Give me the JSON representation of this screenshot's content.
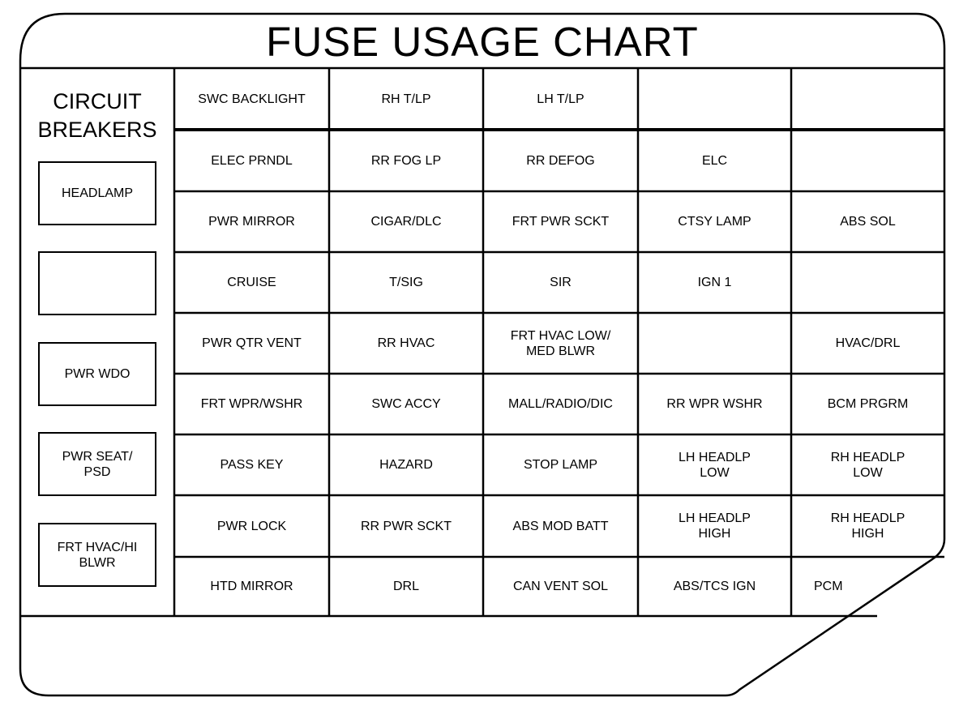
{
  "title": "FUSE USAGE CHART",
  "circuit_breakers": {
    "heading_line1": "CIRCUIT",
    "heading_line2": "BREAKERS",
    "items": [
      "HEADLAMP",
      "",
      "PWR WDO",
      "PWR SEAT/\nPSD",
      "FRT HVAC/HI\nBLWR"
    ]
  },
  "fuses": {
    "rows": [
      [
        "SWC BACKLIGHT",
        "RH T/LP",
        "LH T/LP",
        "",
        ""
      ],
      [
        "ELEC PRNDL",
        "RR FOG LP",
        "RR DEFOG",
        "ELC",
        ""
      ],
      [
        "PWR MIRROR",
        "CIGAR/DLC",
        "FRT PWR SCKT",
        "CTSY LAMP",
        "ABS SOL"
      ],
      [
        "CRUISE",
        "T/SIG",
        "SIR",
        "IGN 1",
        ""
      ],
      [
        "PWR QTR VENT",
        "RR HVAC",
        "FRT HVAC LOW/\nMED BLWR",
        "",
        "HVAC/DRL"
      ],
      [
        "FRT WPR/WSHR",
        "SWC ACCY",
        "MALL/RADIO/DIC",
        "RR WPR WSHR",
        "BCM PRGRM"
      ],
      [
        "PASS KEY",
        "HAZARD",
        "STOP LAMP",
        "LH HEADLP\nLOW",
        "RH HEADLP\nLOW"
      ],
      [
        "PWR LOCK",
        "RR PWR SCKT",
        "ABS MOD BATT",
        "LH HEADLP\nHIGH",
        "RH HEADLP\nHIGH"
      ],
      [
        "HTD MIRROR",
        "DRL",
        "CAN VENT SOL",
        "ABS/TCS IGN",
        "PCM"
      ]
    ]
  },
  "colors": {
    "line": "#000000",
    "background": "#ffffff"
  }
}
